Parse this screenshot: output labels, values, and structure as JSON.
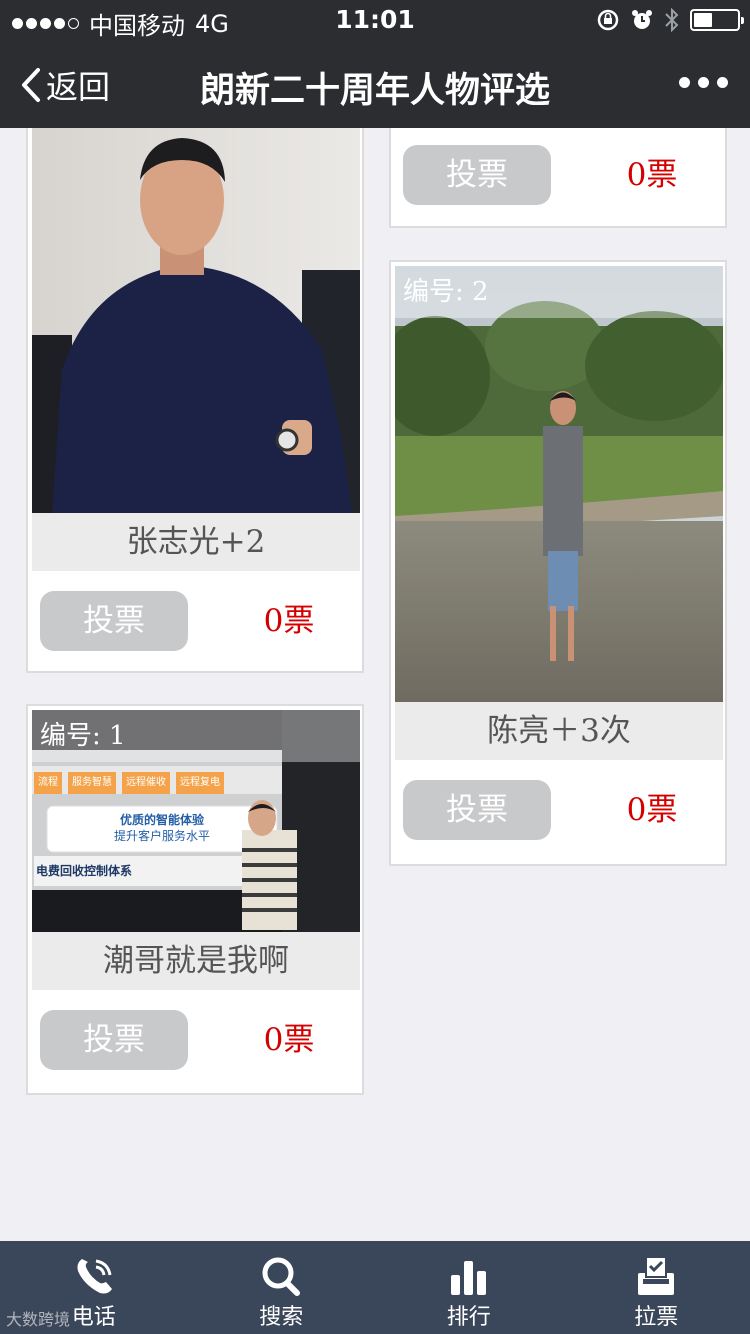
{
  "status": {
    "carrier": "中国移动",
    "network": "4G",
    "time": "11:01"
  },
  "nav": {
    "back_label": "返回",
    "title": "朗新二十周年人物评选"
  },
  "vote_label": "投票",
  "cards": [
    {
      "name": "张志光+2",
      "votes": "0票"
    },
    {
      "votes": "0票"
    },
    {
      "badge": "编号: 2",
      "name": "陈亮＋3次",
      "votes": "0票"
    },
    {
      "badge": "编号: 1",
      "name": "潮哥就是我啊",
      "votes": "0票"
    }
  ],
  "slide": {
    "line1": "优质的智能体验",
    "line2": "提升客户服务水平",
    "line3": "电费回收控制体系",
    "tabs": [
      "流程",
      "服务智慧",
      "远程催收",
      "远程复电"
    ]
  },
  "tabbar": [
    {
      "label": "电话",
      "icon": "phone-icon"
    },
    {
      "label": "搜索",
      "icon": "search-icon"
    },
    {
      "label": "排行",
      "icon": "bar-chart-icon"
    },
    {
      "label": "拉票",
      "icon": "ballot-box-icon"
    }
  ],
  "watermark": "大数跨境",
  "colors": {
    "bar_bg": "#2b2d31",
    "tabbar_bg": "#3a4659",
    "vote_count": "#d40000",
    "vote_button": "#c8c9cb"
  }
}
